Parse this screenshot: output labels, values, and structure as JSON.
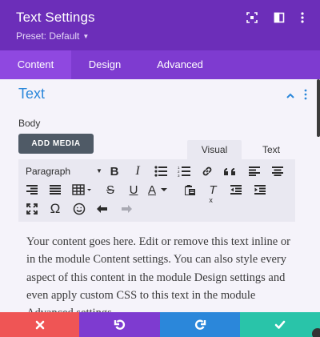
{
  "header": {
    "title": "Text Settings",
    "preset_label": "Preset: Default",
    "bg_color": "#6c2eb9",
    "icons": [
      "fullscreen-icon",
      "split-view-icon",
      "more-options-icon"
    ]
  },
  "tabs": [
    {
      "label": "Content",
      "active": true
    },
    {
      "label": "Design",
      "active": false
    },
    {
      "label": "Advanced",
      "active": false
    }
  ],
  "section": {
    "title": "Text",
    "accent_color": "#2b87da"
  },
  "editor": {
    "body_label": "Body",
    "add_media_label": "ADD MEDIA",
    "view_tabs": {
      "visual": "Visual",
      "text": "Text"
    },
    "format_select": "Paragraph",
    "toolbar_icons": [
      "bold-icon",
      "italic-icon",
      "bullet-list-icon",
      "numbered-list-icon",
      "link-icon",
      "blockquote-icon",
      "align-left-icon",
      "align-center-icon",
      "align-right-icon",
      "justify-icon",
      "table-icon",
      "strikethrough-icon",
      "underline-icon",
      "text-color-icon",
      "paste-text-icon",
      "clear-formatting-icon",
      "outdent-icon",
      "indent-icon",
      "fullscreen-icon",
      "special-character-icon",
      "emoji-icon",
      "undo-icon",
      "redo-icon"
    ],
    "toolbar_glyphs": {
      "bold": "B",
      "italic": "I",
      "strike": "S",
      "underline": "U",
      "text_color": "A",
      "omega": "Ω",
      "clear": "T"
    },
    "content": "Your content goes here. Edit or remove this text inline or in the module Content settings. You can also style every aspect of this content in the module Design settings and even apply custom CSS to this text in the module Advanced settings."
  },
  "footer": {
    "buttons": [
      {
        "name": "cancel",
        "color": "#ef5555",
        "icon": "close-icon"
      },
      {
        "name": "undo",
        "color": "#7e3bd0",
        "icon": "undo-icon"
      },
      {
        "name": "redo",
        "color": "#2b87da",
        "icon": "redo-icon"
      },
      {
        "name": "save",
        "color": "#29c4a9",
        "icon": "check-icon"
      }
    ]
  }
}
